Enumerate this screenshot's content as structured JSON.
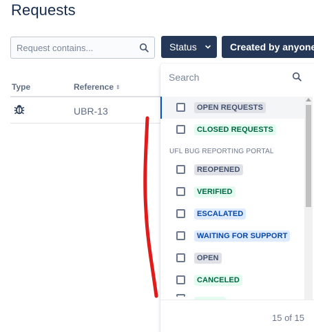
{
  "page": {
    "title": "Requests"
  },
  "search": {
    "placeholder": "Request contains..."
  },
  "toolbar": {
    "status_label": "Status",
    "created_label": "Created by anyone"
  },
  "table": {
    "headers": {
      "type": "Type",
      "reference": "Reference"
    },
    "rows": [
      {
        "type_icon": "bug-icon",
        "reference": "UBR-13"
      }
    ]
  },
  "dropdown": {
    "search_placeholder": "Search",
    "items": [
      {
        "label": "OPEN REQUESTS",
        "style": "grey"
      },
      {
        "label": "CLOSED REQUESTS",
        "style": "green"
      }
    ],
    "group_label": "UFL BUG REPORTING PORTAL",
    "group_items": [
      {
        "label": "REOPENED",
        "style": "grey"
      },
      {
        "label": "VERIFIED",
        "style": "green"
      },
      {
        "label": "ESCALATED",
        "style": "blue"
      },
      {
        "label": "WAITING FOR SUPPORT",
        "style": "blue"
      },
      {
        "label": "OPEN",
        "style": "grey"
      },
      {
        "label": "CANCELED",
        "style": "green"
      }
    ],
    "count_text": "15 of 15"
  },
  "colors": {
    "button_bg": "#253858",
    "annotation_red": "#e01b1b",
    "lozenge_grey": "#dfe1e6",
    "lozenge_green": "#e3fcef",
    "lozenge_blue": "#deebff"
  }
}
